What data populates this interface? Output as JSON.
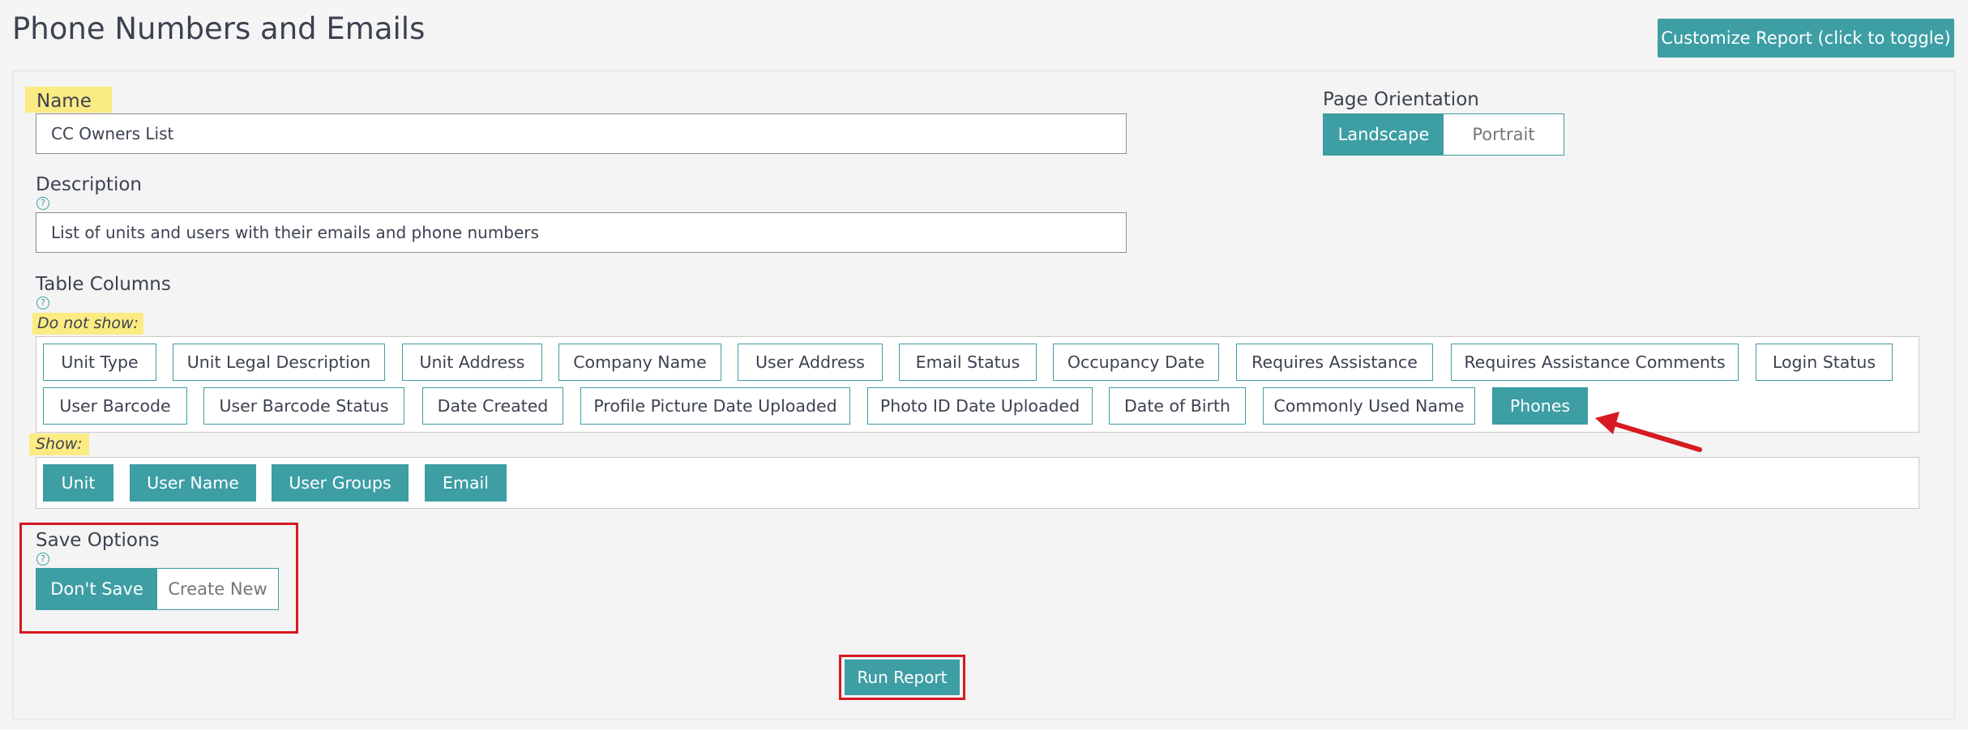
{
  "header": {
    "title": "Phone Numbers and Emails",
    "customize_label": "Customize Report (click to toggle)"
  },
  "name_field": {
    "label": "Name",
    "value": "CC Owners List"
  },
  "description_field": {
    "label": "Description",
    "help": "?",
    "value": "List of units and users with their emails and phone numbers"
  },
  "orientation": {
    "label": "Page Orientation",
    "options": [
      "Landscape",
      "Portrait"
    ],
    "selected": "Landscape"
  },
  "table_columns": {
    "label": "Table Columns",
    "help": "?",
    "hidden_label": "Do not show:",
    "hidden": [
      "Unit Type",
      "Unit Legal Description",
      "Unit Address",
      "Company Name",
      "User Address",
      "Email Status",
      "Occupancy Date",
      "Requires Assistance",
      "Requires Assistance Comments",
      "Login Status",
      "User Barcode",
      "User Barcode Status",
      "Date Created",
      "Profile Picture Date Uploaded",
      "Photo ID Date Uploaded",
      "Date of Birth",
      "Commonly Used Name",
      "Phones"
    ],
    "hidden_selected": "Phones",
    "shown_label": "Show:",
    "shown": [
      "Unit",
      "User Name",
      "User Groups",
      "Email"
    ]
  },
  "save_options": {
    "label": "Save Options",
    "help": "?",
    "options": [
      "Don't Save",
      "Create New"
    ],
    "selected": "Don't Save"
  },
  "run_label": "Run Report",
  "colors": {
    "accent": "#3d9ea4",
    "highlight": "#fbeb83",
    "annotation_red": "#d71920"
  }
}
